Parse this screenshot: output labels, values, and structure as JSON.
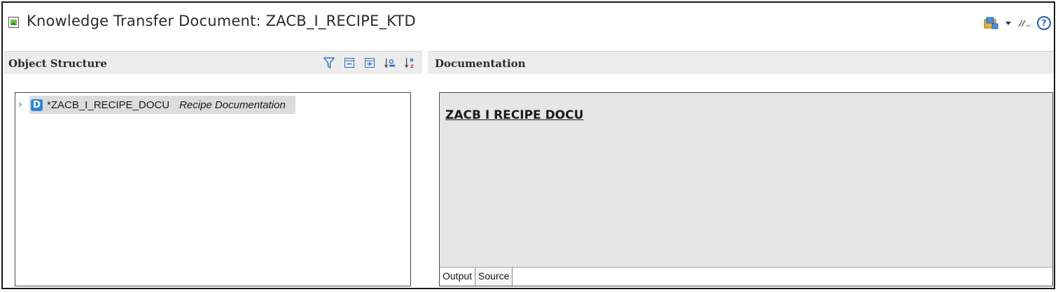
{
  "header": {
    "title": "Knowledge Transfer Document: ZACB_I_RECIPE_KTD",
    "icons": [
      "document-icon",
      "open-object-icon",
      "dropdown-arrow-icon",
      "link-icon",
      "help-icon"
    ],
    "help_label": "?"
  },
  "object_structure": {
    "title": "Object Structure",
    "toolbar_icons": [
      "filter-icon",
      "collapse-all-icon",
      "expand-all-icon",
      "sort-by-type-icon",
      "sort-alphabetical-icon"
    ],
    "tree": [
      {
        "icon_letter": "D",
        "name": "*ZACB_I_RECIPE_DOCU",
        "description": "Recipe Documentation",
        "selected": true,
        "expandable": true
      }
    ]
  },
  "documentation": {
    "title": "Documentation",
    "heading": "ZACB I RECIPE DOCU",
    "tabs": [
      {
        "label": "Output",
        "active": true
      },
      {
        "label": "Source",
        "active": false
      }
    ]
  },
  "colors": {
    "panel_header_bg": "#ececec",
    "doc_bg": "#e6e6e6",
    "selection_bg": "#dcdcdc",
    "d_icon_blue": "#2e86d6"
  }
}
